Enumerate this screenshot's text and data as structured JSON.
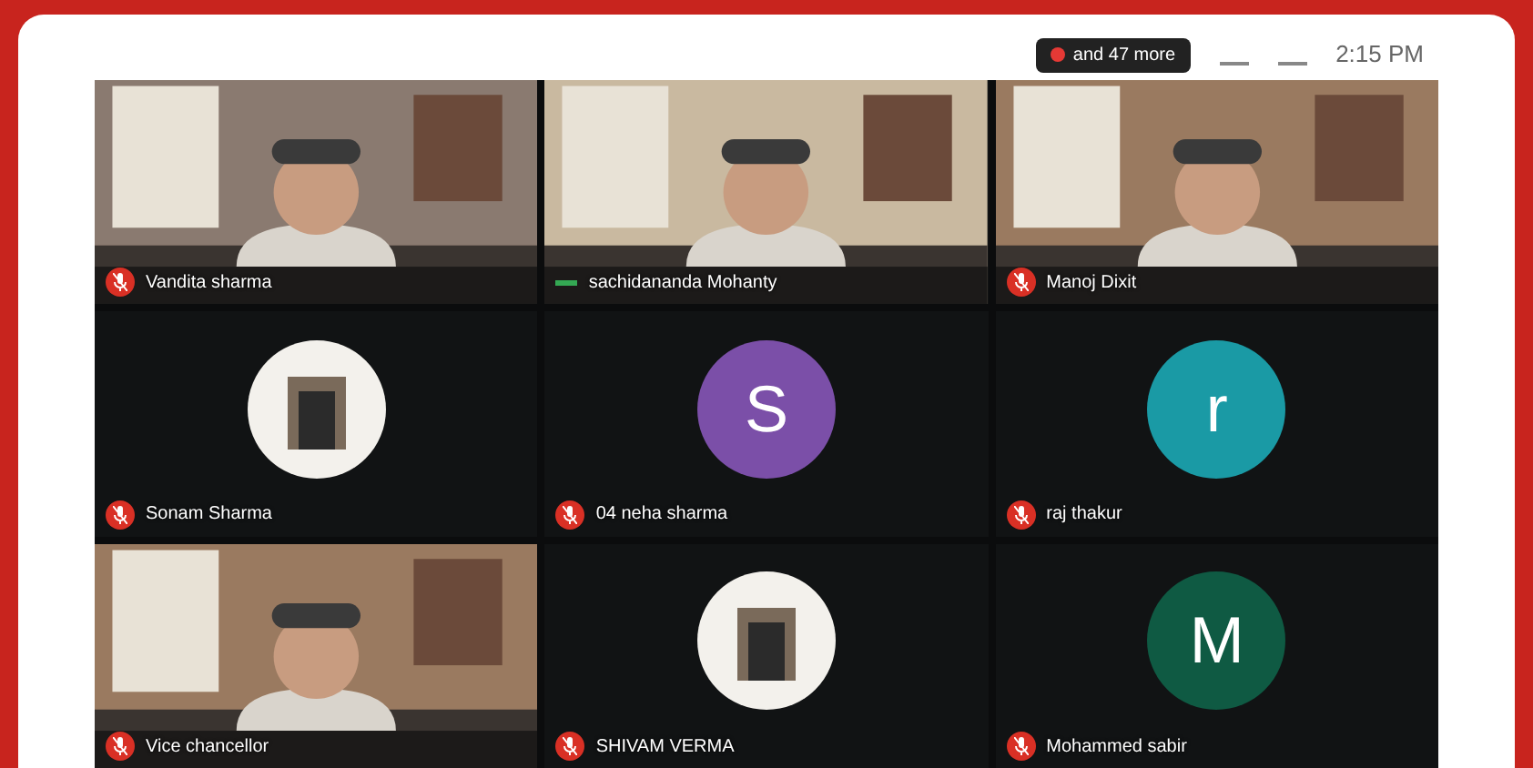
{
  "top_bar": {
    "others": "and 47 more",
    "time": "2:15 PM"
  },
  "tiles": [
    {
      "kind": "video",
      "name": "Vandita sharma",
      "muted": true
    },
    {
      "kind": "video",
      "name": "sachidananda Mohanty",
      "muted": false
    },
    {
      "kind": "video",
      "name": "Manoj Dixit",
      "muted": true
    },
    {
      "name": "Sonam Sharma",
      "muted": true
    },
    {
      "kind": "letter",
      "letter": "S",
      "name": "04 neha sharma",
      "muted": true,
      "color": "#7b4fa8"
    },
    {
      "kind": "letter",
      "letter": "r",
      "name": "raj thakur",
      "muted": true,
      "color": "#1a9aa5"
    },
    {
      "kind": "video",
      "name": "Vice chancellor",
      "muted": true
    },
    {
      "name": "SHIVAM VERMA",
      "muted": true
    },
    {
      "kind": "letter",
      "letter": "M",
      "name": "Mohammed sabir",
      "muted": true,
      "color": "#0f5a43"
    }
  ]
}
